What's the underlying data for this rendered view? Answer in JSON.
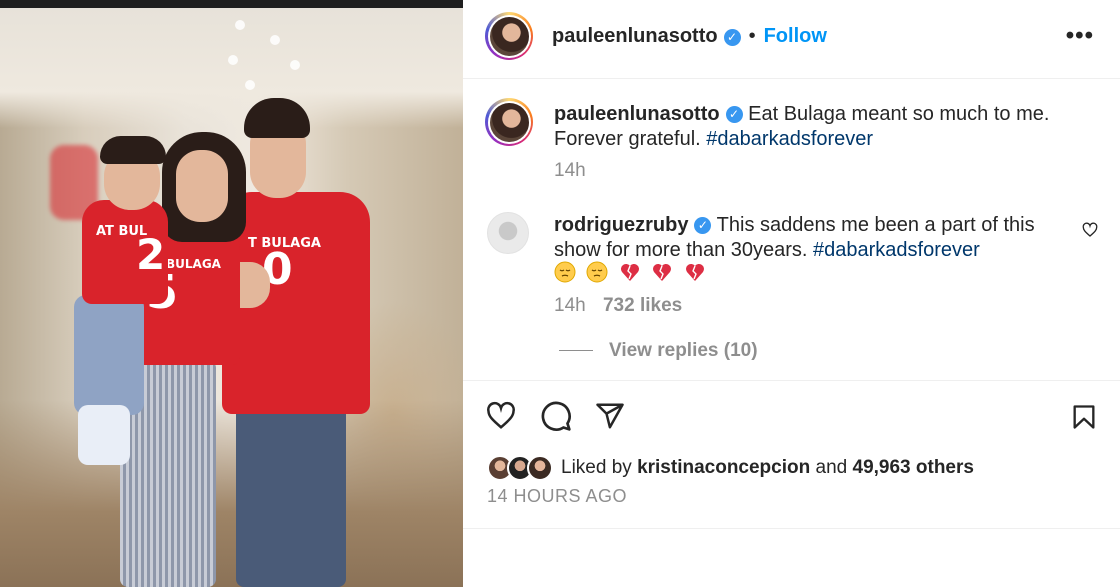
{
  "post_header": {
    "username": "pauleenlunasotto",
    "separator": "•",
    "follow_label": "Follow",
    "more_label": "•••"
  },
  "caption": {
    "username": "pauleenlunasotto",
    "text": "Eat Bulaga meant so much to me. Forever grateful.",
    "hashtag": "#dabarkadsforever",
    "time": "14h"
  },
  "comment": {
    "username": "rodriguezruby",
    "text": "This saddens me been a part of this show for more than 30years.",
    "hashtag": "#dabarkadsforever",
    "emoji_names": [
      "pensive-face",
      "pensive-face",
      "broken-heart",
      "broken-heart",
      "broken-heart"
    ],
    "time": "14h",
    "likes": "732 likes",
    "view_replies": "View replies (10)"
  },
  "actions": {
    "icons": [
      "heart-icon",
      "comment-icon",
      "share-icon",
      "bookmark-icon"
    ]
  },
  "likes_summary": {
    "prefix": "Liked by",
    "user": "kristinaconcepcion",
    "middle": "and",
    "count": "49,963 others"
  },
  "posted_ago": "14 HOURS AGO",
  "photo": {
    "jersey_left": "AT BUL",
    "jersey_mid": "BULAGA",
    "jersey_right": "T BULAGA",
    "num_left": "2",
    "num_mid": "5",
    "num_right": "0"
  },
  "colors": {
    "link_blue": "#0095f6",
    "hashtag": "#00376b",
    "verified": "#3897f0",
    "muted": "#8e8e8e",
    "jersey_red": "#d9232b"
  }
}
